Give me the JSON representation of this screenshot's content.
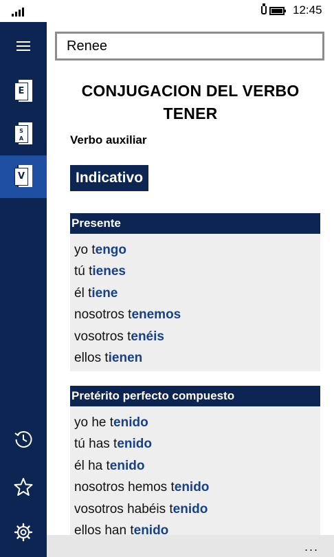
{
  "status_bar": {
    "time": "12:45"
  },
  "sidebar": {
    "items": [
      {
        "name": "menu",
        "icon": "hamburger-menu-icon"
      },
      {
        "name": "dictionary-en",
        "letter": "E",
        "icon": "book-icon"
      },
      {
        "name": "dictionary-sa",
        "letter_top": "S",
        "letter_bottom": "A",
        "icon": "book-icon"
      },
      {
        "name": "verbs",
        "letter": "V",
        "icon": "book-icon",
        "active": true
      },
      {
        "name": "history",
        "icon": "history-icon"
      },
      {
        "name": "favorites",
        "icon": "star-icon"
      },
      {
        "name": "settings",
        "icon": "gear-icon"
      }
    ]
  },
  "search": {
    "value": "Renee"
  },
  "main": {
    "title_line1": "CONJUGACION DEL VERBO",
    "title_line2": "TENER",
    "subtitle": "Verbo auxiliar",
    "mood": "Indicativo",
    "tenses": [
      {
        "name": "Presente",
        "rows": [
          {
            "prefix": "yo t",
            "ending": "engo"
          },
          {
            "prefix": "tú t",
            "ending": "ienes"
          },
          {
            "prefix": "él t",
            "ending": "iene"
          },
          {
            "prefix": "nosotros t",
            "ending": "enemos"
          },
          {
            "prefix": "vosotros t",
            "ending": "enéis"
          },
          {
            "prefix": "ellos t",
            "ending": "ienen"
          }
        ]
      },
      {
        "name": "Pretérito perfecto compuesto",
        "rows": [
          {
            "prefix": "yo he t",
            "ending": "enido"
          },
          {
            "prefix": "tú has t",
            "ending": "enido"
          },
          {
            "prefix": "él ha t",
            "ending": "enido"
          },
          {
            "prefix": "nosotros hemos t",
            "ending": "enido"
          },
          {
            "prefix": "vosotros habéis t",
            "ending": "enido"
          },
          {
            "prefix": "ellos han t",
            "ending": "enido"
          }
        ]
      }
    ]
  },
  "app_bar": {
    "more": "..."
  },
  "colors": {
    "sidebar": "#0c2552",
    "sidebar_active": "#1e4fa0",
    "ending": "#16408a",
    "table_bg": "#eeeeee"
  }
}
